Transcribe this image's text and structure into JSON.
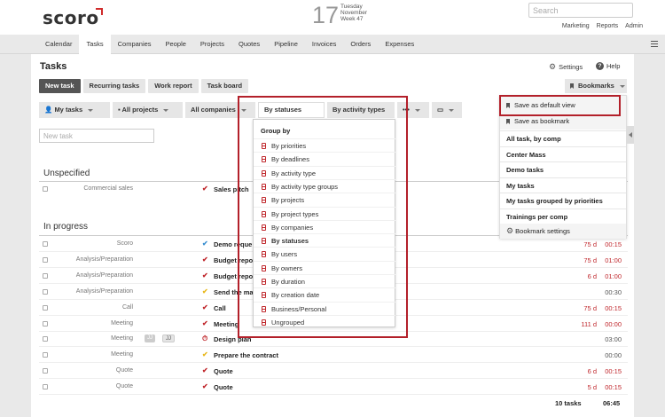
{
  "header": {
    "logo": "scoro",
    "date_day": "17",
    "date_weekday": "Tuesday",
    "date_month": "November",
    "date_week": "Week 47",
    "search_placeholder": "Search",
    "links": [
      "Marketing",
      "Reports",
      "Admin"
    ]
  },
  "nav": {
    "items": [
      "Calendar",
      "Tasks",
      "Companies",
      "People",
      "Projects",
      "Quotes",
      "Pipeline",
      "Invoices",
      "Orders",
      "Expenses"
    ],
    "active": "Tasks"
  },
  "page": {
    "title": "Tasks",
    "settings_label": "Settings",
    "help_label": "Help",
    "tabs": [
      "New task",
      "Recurring tasks",
      "Work report",
      "Task board"
    ],
    "bookmarks_label": "Bookmarks",
    "new_task_placeholder": "New task",
    "filters": {
      "my_tasks": "My tasks",
      "all_projects": "All projects",
      "all_companies": "All companies",
      "by_statuses": "By statuses",
      "by_activity_types": "By activity types",
      "more": "•••"
    }
  },
  "sections": {
    "unspecified": "Unspecified",
    "in_progress": "In progress"
  },
  "rows": [
    {
      "type": "Commercial sales",
      "name": "Sales pitch",
      "check": "red",
      "days": "",
      "time": ""
    },
    {
      "type": "Scoro",
      "name": "Demo reque",
      "check": "blue",
      "days": "75 d",
      "time": "00:15",
      "time_color": "red"
    },
    {
      "type": "Analysis/Preparation",
      "name": "Budget repo",
      "check": "red",
      "days": "75 d",
      "time": "01:00",
      "time_color": "red"
    },
    {
      "type": "Analysis/Preparation",
      "name": "Budget repo",
      "check": "red",
      "days": "6 d",
      "time": "01:00",
      "time_color": "red"
    },
    {
      "type": "Analysis/Preparation",
      "name": "Send the ma",
      "check": "yellow",
      "days": "",
      "time": "00:30",
      "time_color": "grey"
    },
    {
      "type": "Call",
      "name": "Call",
      "check": "red",
      "days": "75 d",
      "time": "00:15",
      "time_color": "red"
    },
    {
      "type": "Meeting",
      "name": "Meeting",
      "check": "red",
      "days": "111 d",
      "time": "00:00",
      "time_color": "red"
    },
    {
      "type": "Meeting",
      "name": "Design plan",
      "check": "timer",
      "days": "",
      "time": "03:00",
      "time_color": "grey",
      "badges": [
        "JJ",
        "JJ"
      ]
    },
    {
      "type": "Meeting",
      "name": "Prepare the contract",
      "check": "yellow",
      "days": "",
      "time": "00:00",
      "time_color": "grey"
    },
    {
      "type": "Quote",
      "name": "Quote",
      "check": "red",
      "days": "6 d",
      "time": "00:15",
      "time_color": "red"
    },
    {
      "type": "Quote",
      "name": "Quote",
      "check": "red",
      "days": "5 d",
      "time": "00:15",
      "time_color": "red"
    }
  ],
  "totals": {
    "count": "10 tasks",
    "time": "06:45"
  },
  "groupby_dropdown": {
    "header": "Group by",
    "items": [
      "By priorities",
      "By deadlines",
      "By activity type",
      "By activity type groups",
      "By projects",
      "By project types",
      "By companies",
      "By statuses",
      "By users",
      "By owners",
      "By duration",
      "By creation date",
      "Business/Personal",
      "Ungrouped"
    ],
    "selected": "By statuses"
  },
  "bookmarks_menu": {
    "save_default": "Save as default view",
    "save_bookmark": "Save as bookmark",
    "items": [
      "All task, by comp",
      "Center Mass",
      "Demo tasks",
      "My tasks",
      "My tasks grouped by priorities",
      "Trainings per comp"
    ],
    "settings": "Bookmark settings"
  },
  "colors": {
    "accent_red": "#c0282d",
    "check_red": "#c0282d",
    "check_blue": "#3a8fd0",
    "check_yellow": "#e8b81e",
    "highlight": "#b3202a"
  }
}
